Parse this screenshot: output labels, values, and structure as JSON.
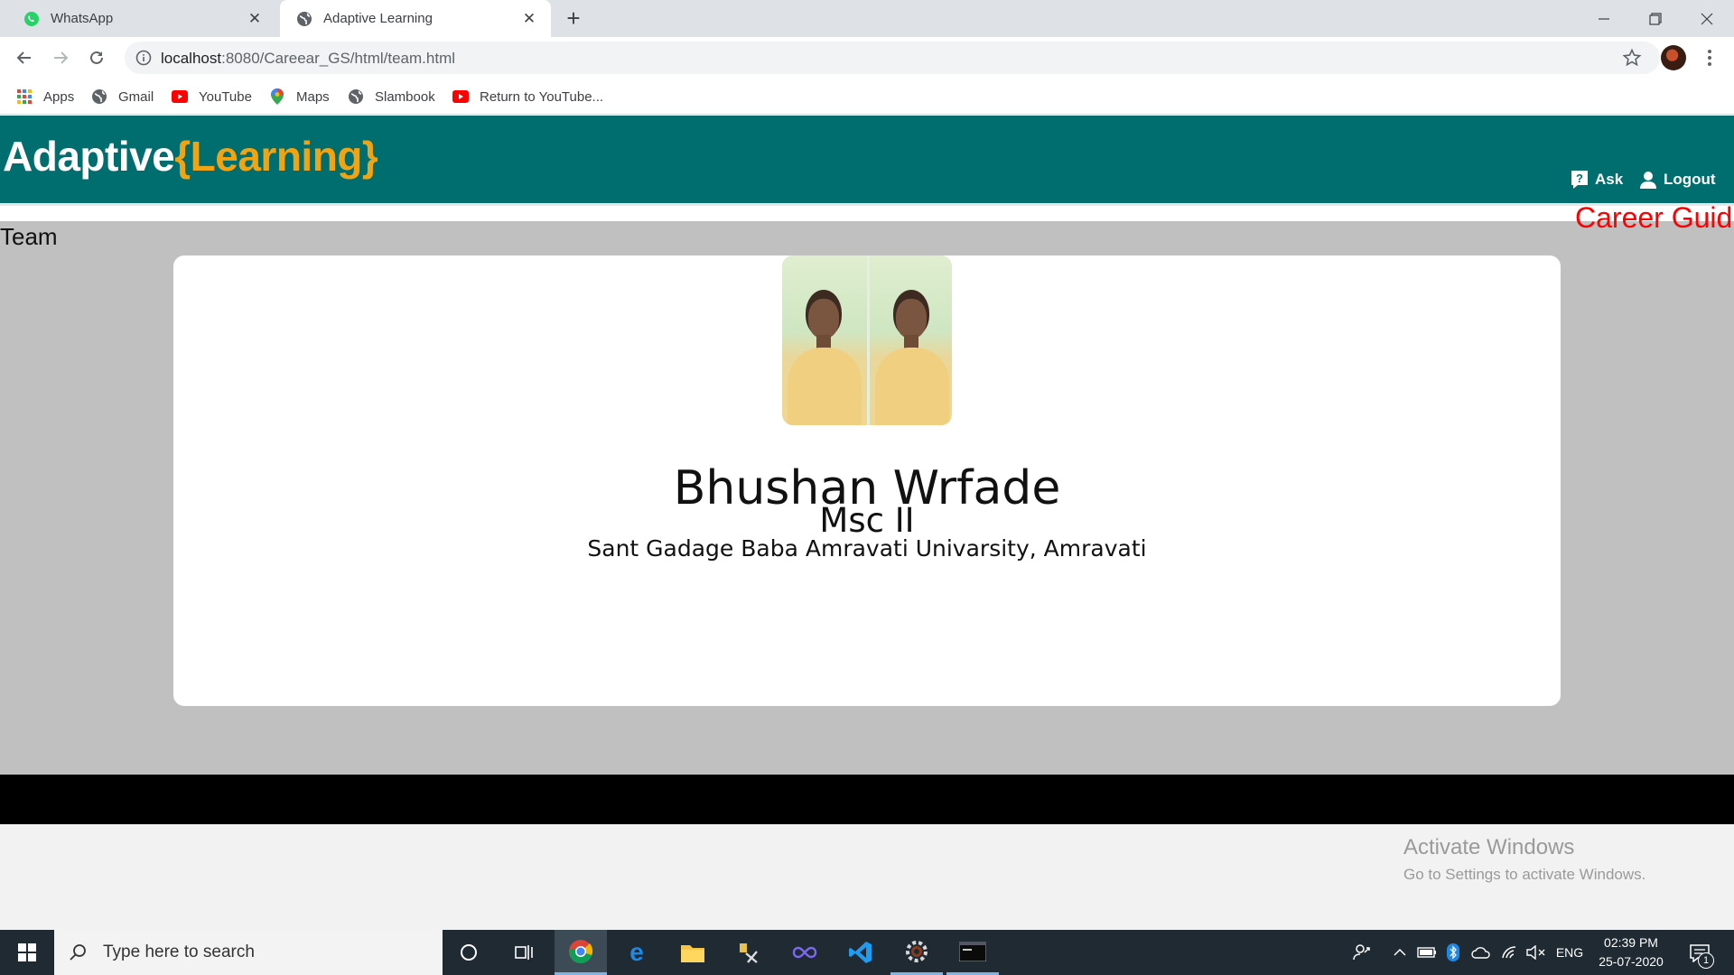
{
  "browser": {
    "tabs": [
      {
        "title": "WhatsApp",
        "icon": "whatsapp-icon"
      },
      {
        "title": "Adaptive Learning",
        "icon": "globe-icon"
      }
    ],
    "active_tab": 1,
    "url_host": "localhost",
    "url_path": ":8080/Careear_GS/html/team.html",
    "bookmarks": [
      {
        "label": "Apps",
        "icon": "apps-grid-icon"
      },
      {
        "label": "Gmail",
        "icon": "globe-icon"
      },
      {
        "label": "YouTube",
        "icon": "youtube-icon"
      },
      {
        "label": "Maps",
        "icon": "maps-pin-icon"
      },
      {
        "label": "Slambook",
        "icon": "globe-icon"
      },
      {
        "label": "Return to YouTube...",
        "icon": "youtube-icon"
      }
    ]
  },
  "site": {
    "brand_main": "Adaptive",
    "brand_accent": "{Learning}",
    "nav": {
      "ask": "Ask",
      "logout": "Logout"
    },
    "marquee": "Career Guid",
    "section_title": "Team",
    "member": {
      "name": "Bhushan Wrfade",
      "course": "Msc II",
      "university": "Sant Gadage Baba Amravati Univarsity, Amravati"
    },
    "colors": {
      "header_bg": "#006d6f",
      "accent": "#f0a413",
      "marquee": "#ff0000",
      "content_bg": "#c0c0c0"
    }
  },
  "watermark": {
    "title": "Activate Windows",
    "subtitle": "Go to Settings to activate Windows."
  },
  "taskbar": {
    "search_placeholder": "Type here to search",
    "language": "ENG",
    "time": "02:39 PM",
    "date": "25-07-2020",
    "notification_count": "1"
  }
}
